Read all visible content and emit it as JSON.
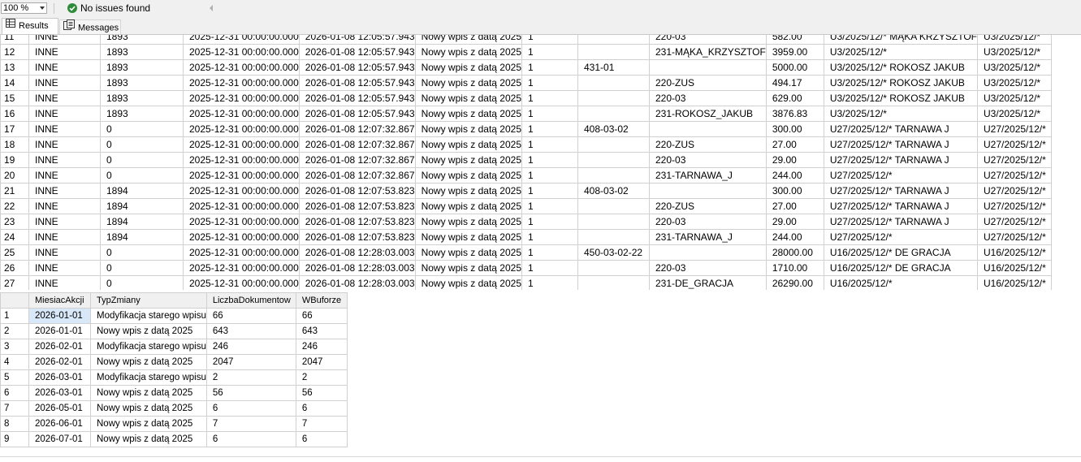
{
  "status": {
    "zoom": "100 %",
    "issues": "No issues found"
  },
  "tabs": {
    "results": "Results",
    "messages": "Messages"
  },
  "grid1": {
    "rows": [
      [
        "11",
        "INNE",
        "1893",
        "2025-12-31 00:00:00.000",
        "2026-01-08 12:05:57.943",
        "Nowy wpis z datą 2025",
        "1",
        "",
        "220-03",
        "582.00",
        "U3/2025/12/* MĄKA KRZYSZTOF",
        "U3/2025/12/*"
      ],
      [
        "12",
        "INNE",
        "1893",
        "2025-12-31 00:00:00.000",
        "2026-01-08 12:05:57.943",
        "Nowy wpis z datą 2025",
        "1",
        "",
        "231-MĄKA_KRZYSZTOF",
        "3959.00",
        "U3/2025/12/*",
        "U3/2025/12/*"
      ],
      [
        "13",
        "INNE",
        "1893",
        "2025-12-31 00:00:00.000",
        "2026-01-08 12:05:57.943",
        "Nowy wpis z datą 2025",
        "1",
        "431-01",
        "",
        "5000.00",
        "U3/2025/12/* ROKOSZ JAKUB",
        "U3/2025/12/*"
      ],
      [
        "14",
        "INNE",
        "1893",
        "2025-12-31 00:00:00.000",
        "2026-01-08 12:05:57.943",
        "Nowy wpis z datą 2025",
        "1",
        "",
        "220-ZUS",
        "494.17",
        "U3/2025/12/* ROKOSZ JAKUB",
        "U3/2025/12/*"
      ],
      [
        "15",
        "INNE",
        "1893",
        "2025-12-31 00:00:00.000",
        "2026-01-08 12:05:57.943",
        "Nowy wpis z datą 2025",
        "1",
        "",
        "220-03",
        "629.00",
        "U3/2025/12/* ROKOSZ JAKUB",
        "U3/2025/12/*"
      ],
      [
        "16",
        "INNE",
        "1893",
        "2025-12-31 00:00:00.000",
        "2026-01-08 12:05:57.943",
        "Nowy wpis z datą 2025",
        "1",
        "",
        "231-ROKOSZ_JAKUB",
        "3876.83",
        "U3/2025/12/*",
        "U3/2025/12/*"
      ],
      [
        "17",
        "INNE",
        "0",
        "2025-12-31 00:00:00.000",
        "2026-01-08 12:07:32.867",
        "Nowy wpis z datą 2025",
        "1",
        "408-03-02",
        "",
        "300.00",
        "U27/2025/12/* TARNAWA J",
        "U27/2025/12/*"
      ],
      [
        "18",
        "INNE",
        "0",
        "2025-12-31 00:00:00.000",
        "2026-01-08 12:07:32.867",
        "Nowy wpis z datą 2025",
        "1",
        "",
        "220-ZUS",
        "27.00",
        "U27/2025/12/* TARNAWA J",
        "U27/2025/12/*"
      ],
      [
        "19",
        "INNE",
        "0",
        "2025-12-31 00:00:00.000",
        "2026-01-08 12:07:32.867",
        "Nowy wpis z datą 2025",
        "1",
        "",
        "220-03",
        "29.00",
        "U27/2025/12/* TARNAWA J",
        "U27/2025/12/*"
      ],
      [
        "20",
        "INNE",
        "0",
        "2025-12-31 00:00:00.000",
        "2026-01-08 12:07:32.867",
        "Nowy wpis z datą 2025",
        "1",
        "",
        "231-TARNAWA_J",
        "244.00",
        "U27/2025/12/*",
        "U27/2025/12/*"
      ],
      [
        "21",
        "INNE",
        "1894",
        "2025-12-31 00:00:00.000",
        "2026-01-08 12:07:53.823",
        "Nowy wpis z datą 2025",
        "1",
        "408-03-02",
        "",
        "300.00",
        "U27/2025/12/* TARNAWA J",
        "U27/2025/12/*"
      ],
      [
        "22",
        "INNE",
        "1894",
        "2025-12-31 00:00:00.000",
        "2026-01-08 12:07:53.823",
        "Nowy wpis z datą 2025",
        "1",
        "",
        "220-ZUS",
        "27.00",
        "U27/2025/12/* TARNAWA J",
        "U27/2025/12/*"
      ],
      [
        "23",
        "INNE",
        "1894",
        "2025-12-31 00:00:00.000",
        "2026-01-08 12:07:53.823",
        "Nowy wpis z datą 2025",
        "1",
        "",
        "220-03",
        "29.00",
        "U27/2025/12/* TARNAWA J",
        "U27/2025/12/*"
      ],
      [
        "24",
        "INNE",
        "1894",
        "2025-12-31 00:00:00.000",
        "2026-01-08 12:07:53.823",
        "Nowy wpis z datą 2025",
        "1",
        "",
        "231-TARNAWA_J",
        "244.00",
        "U27/2025/12/*",
        "U27/2025/12/*"
      ],
      [
        "25",
        "INNE",
        "0",
        "2025-12-31 00:00:00.000",
        "2026-01-08 12:28:03.003",
        "Nowy wpis z datą 2025",
        "1",
        "450-03-02-22",
        "",
        "28000.00",
        "U16/2025/12/* DE GRACJA",
        "U16/2025/12/*"
      ],
      [
        "26",
        "INNE",
        "0",
        "2025-12-31 00:00:00.000",
        "2026-01-08 12:28:03.003",
        "Nowy wpis z datą 2025",
        "1",
        "",
        "220-03",
        "1710.00",
        "U16/2025/12/* DE GRACJA",
        "U16/2025/12/*"
      ],
      [
        "27",
        "INNE",
        "0",
        "2025-12-31 00:00:00.000",
        "2026-01-08 12:28:03.003",
        "Nowy wpis z datą 2025",
        "1",
        "",
        "231-DE_GRACJA",
        "26290.00",
        "U16/2025/12/*",
        "U16/2025/12/*"
      ]
    ]
  },
  "grid2": {
    "headers": [
      "",
      "MiesiacAkcji",
      "TypZmiany",
      "LiczbaDokumentow",
      "WBuforze"
    ],
    "rows": [
      [
        "1",
        "2026-01-01",
        "Modyfikacja starego wpisu",
        "66",
        "66"
      ],
      [
        "2",
        "2026-01-01",
        "Nowy wpis z datą 2025",
        "643",
        "643"
      ],
      [
        "3",
        "2026-02-01",
        "Modyfikacja starego wpisu",
        "246",
        "246"
      ],
      [
        "4",
        "2026-02-01",
        "Nowy wpis z datą 2025",
        "2047",
        "2047"
      ],
      [
        "5",
        "2026-03-01",
        "Modyfikacja starego wpisu",
        "2",
        "2"
      ],
      [
        "6",
        "2026-03-01",
        "Nowy wpis z datą 2025",
        "56",
        "56"
      ],
      [
        "7",
        "2026-05-01",
        "Nowy wpis z datą 2025",
        "6",
        "6"
      ],
      [
        "8",
        "2026-06-01",
        "Nowy wpis z datą 2025",
        "7",
        "7"
      ],
      [
        "9",
        "2026-07-01",
        "Nowy wpis z datą 2025",
        "6",
        "6"
      ]
    ]
  },
  "colors": {
    "ok": "#2e8b3a",
    "grid_border": "#d0d0d0",
    "header_bg": "#f0f0f0",
    "selected_bg": "#d8e8f8"
  }
}
